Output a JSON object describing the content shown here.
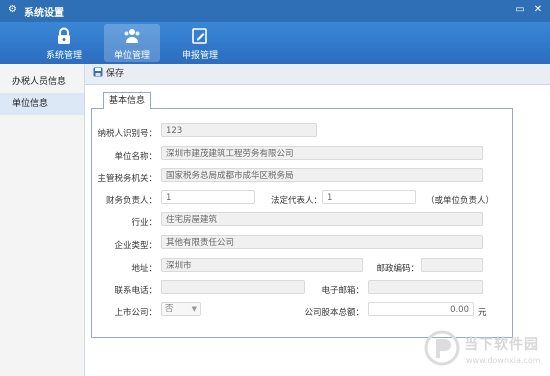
{
  "window": {
    "title": "系统设置"
  },
  "toolbar": {
    "items": [
      {
        "label": "系统管理",
        "icon": "lock-icon"
      },
      {
        "label": "单位管理",
        "icon": "users-icon"
      },
      {
        "label": "申报管理",
        "icon": "edit-doc-icon"
      }
    ],
    "active_index": 1
  },
  "sidebar": {
    "items": [
      {
        "label": "办税人员信息"
      },
      {
        "label": "单位信息"
      }
    ]
  },
  "actions": {
    "save_label": "保存"
  },
  "tab": {
    "label": "基本信息"
  },
  "form": {
    "taxpayer_id": {
      "label": "纳税人识别号：",
      "value": "123"
    },
    "unit_name": {
      "label": "单位名称：",
      "value": "深圳市建茂建筑工程劳务有限公司"
    },
    "tax_authority": {
      "label": "主管税务机关：",
      "value": "国家税务总局成都市成华区税务局"
    },
    "finance_head": {
      "label": "财务负责人：",
      "value": "1"
    },
    "legal_rep": {
      "label": "法定代表人：",
      "value": "1"
    },
    "legal_rep_note": "（或单位负责人）",
    "industry": {
      "label": "行业：",
      "value": "住宅房屋建筑"
    },
    "company_type": {
      "label": "企业类型：",
      "value": "其他有限责任公司"
    },
    "address": {
      "label": "地址：",
      "value": "深圳市"
    },
    "postcode": {
      "label": "邮政编码：",
      "value": ""
    },
    "phone": {
      "label": "联系电话：",
      "value": ""
    },
    "email": {
      "label": "电子邮箱：",
      "value": ""
    },
    "listed": {
      "label": "上市公司：",
      "value": "否"
    },
    "capital": {
      "label": "公司股本总额：",
      "value": "0.00",
      "unit": "元"
    }
  },
  "watermark": {
    "brand": "当下软件园",
    "url": "www.downxia.com"
  },
  "colors": {
    "titlebar": "#2e6fb5",
    "toolbar": "#3a86d6",
    "sidebar_active": "#dde8f6"
  }
}
